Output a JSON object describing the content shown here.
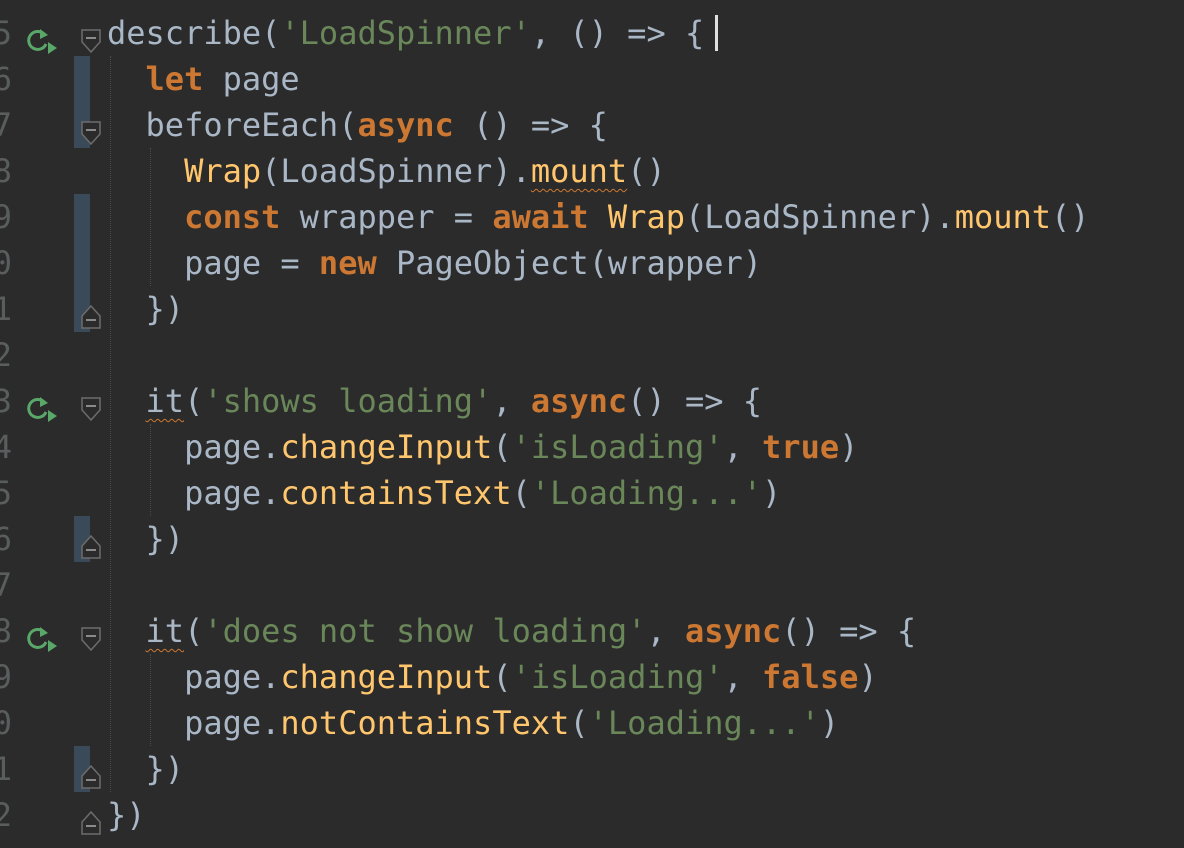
{
  "editor": {
    "colors": {
      "background": "#2b2b2b",
      "default": "#a9b7c6",
      "keyword": "#cc7832",
      "string": "#6a8759",
      "function": "#ffc66d",
      "line_number": "#5a5d5e",
      "run_icon": "#59a869"
    },
    "lines": [
      {
        "num": "5",
        "run": true,
        "fold": "open",
        "tokens": [
          {
            "t": "describe(",
            "c": "default"
          },
          {
            "t": "'LoadSpinner'",
            "c": "str"
          },
          {
            "t": ", () => {",
            "c": "default"
          }
        ]
      },
      {
        "num": "6",
        "tokens": [
          {
            "t": "  ",
            "c": "ws"
          },
          {
            "t": "let",
            "c": "kw"
          },
          {
            "t": " page",
            "c": "default"
          }
        ]
      },
      {
        "num": "7",
        "fold": "open",
        "tokens": [
          {
            "t": "  ",
            "c": "ws"
          },
          {
            "t": "beforeEach(",
            "c": "default"
          },
          {
            "t": "async",
            "c": "kw"
          },
          {
            "t": " () => {",
            "c": "default"
          }
        ]
      },
      {
        "num": "8",
        "tokens": [
          {
            "t": "    ",
            "c": "ws"
          },
          {
            "t": "Wrap",
            "c": "fn"
          },
          {
            "t": "(LoadSpinner).",
            "c": "default"
          },
          {
            "t": "mount",
            "c": "fn",
            "wavy": true
          },
          {
            "t": "()",
            "c": "default"
          }
        ]
      },
      {
        "num": "9",
        "tokens": [
          {
            "t": "    ",
            "c": "ws"
          },
          {
            "t": "const",
            "c": "kw"
          },
          {
            "t": " wrapper = ",
            "c": "default"
          },
          {
            "t": "await",
            "c": "kw"
          },
          {
            "t": " ",
            "c": "default"
          },
          {
            "t": "Wrap",
            "c": "fn"
          },
          {
            "t": "(LoadSpinner).",
            "c": "default"
          },
          {
            "t": "mount",
            "c": "fn"
          },
          {
            "t": "()",
            "c": "default"
          }
        ]
      },
      {
        "num": "0",
        "tokens": [
          {
            "t": "    ",
            "c": "ws"
          },
          {
            "t": "page = ",
            "c": "default"
          },
          {
            "t": "new",
            "c": "kw"
          },
          {
            "t": " PageObject(wrapper)",
            "c": "default"
          }
        ]
      },
      {
        "num": "1",
        "fold": "close",
        "tokens": [
          {
            "t": "  ",
            "c": "ws"
          },
          {
            "t": "})",
            "c": "default"
          }
        ]
      },
      {
        "num": "2",
        "tokens": []
      },
      {
        "num": "3",
        "run": true,
        "fold": "open",
        "tokens": [
          {
            "t": "  ",
            "c": "ws"
          },
          {
            "t": "it",
            "c": "default",
            "wavy": true
          },
          {
            "t": "(",
            "c": "default"
          },
          {
            "t": "'shows loading'",
            "c": "str"
          },
          {
            "t": ", ",
            "c": "default"
          },
          {
            "t": "async",
            "c": "kw"
          },
          {
            "t": "() => {",
            "c": "default"
          }
        ]
      },
      {
        "num": "4",
        "tokens": [
          {
            "t": "    ",
            "c": "ws"
          },
          {
            "t": "page.",
            "c": "default"
          },
          {
            "t": "changeInput",
            "c": "fn"
          },
          {
            "t": "(",
            "c": "default"
          },
          {
            "t": "'isLoading'",
            "c": "str"
          },
          {
            "t": ", ",
            "c": "default"
          },
          {
            "t": "true",
            "c": "kw"
          },
          {
            "t": ")",
            "c": "default"
          }
        ]
      },
      {
        "num": "5",
        "tokens": [
          {
            "t": "    ",
            "c": "ws"
          },
          {
            "t": "page.",
            "c": "default"
          },
          {
            "t": "containsText",
            "c": "fn"
          },
          {
            "t": "(",
            "c": "default"
          },
          {
            "t": "'Loading...'",
            "c": "str"
          },
          {
            "t": ")",
            "c": "default"
          }
        ]
      },
      {
        "num": "6",
        "fold": "close",
        "tokens": [
          {
            "t": "  ",
            "c": "ws"
          },
          {
            "t": "})",
            "c": "default"
          }
        ]
      },
      {
        "num": "7",
        "tokens": []
      },
      {
        "num": "8",
        "run": true,
        "fold": "open",
        "tokens": [
          {
            "t": "  ",
            "c": "ws"
          },
          {
            "t": "it",
            "c": "default",
            "wavy": true
          },
          {
            "t": "(",
            "c": "default"
          },
          {
            "t": "'does not show loading'",
            "c": "str"
          },
          {
            "t": ", ",
            "c": "default"
          },
          {
            "t": "async",
            "c": "kw"
          },
          {
            "t": "() => {",
            "c": "default"
          }
        ]
      },
      {
        "num": "9",
        "tokens": [
          {
            "t": "    ",
            "c": "ws"
          },
          {
            "t": "page.",
            "c": "default"
          },
          {
            "t": "changeInput",
            "c": "fn"
          },
          {
            "t": "(",
            "c": "default"
          },
          {
            "t": "'isLoading'",
            "c": "str"
          },
          {
            "t": ", ",
            "c": "default"
          },
          {
            "t": "false",
            "c": "kw"
          },
          {
            "t": ")",
            "c": "default"
          }
        ]
      },
      {
        "num": "0",
        "tokens": [
          {
            "t": "    ",
            "c": "ws"
          },
          {
            "t": "page.",
            "c": "default"
          },
          {
            "t": "notContainsText",
            "c": "fn"
          },
          {
            "t": "(",
            "c": "default"
          },
          {
            "t": "'Loading...'",
            "c": "str"
          },
          {
            "t": ")",
            "c": "default"
          }
        ]
      },
      {
        "num": "1",
        "fold": "close",
        "tokens": [
          {
            "t": "  ",
            "c": "ws"
          },
          {
            "t": "})",
            "c": "default"
          }
        ]
      },
      {
        "num": "2",
        "fold": "close",
        "tokens": [
          {
            "t": "})",
            "c": "default"
          }
        ]
      }
    ]
  }
}
